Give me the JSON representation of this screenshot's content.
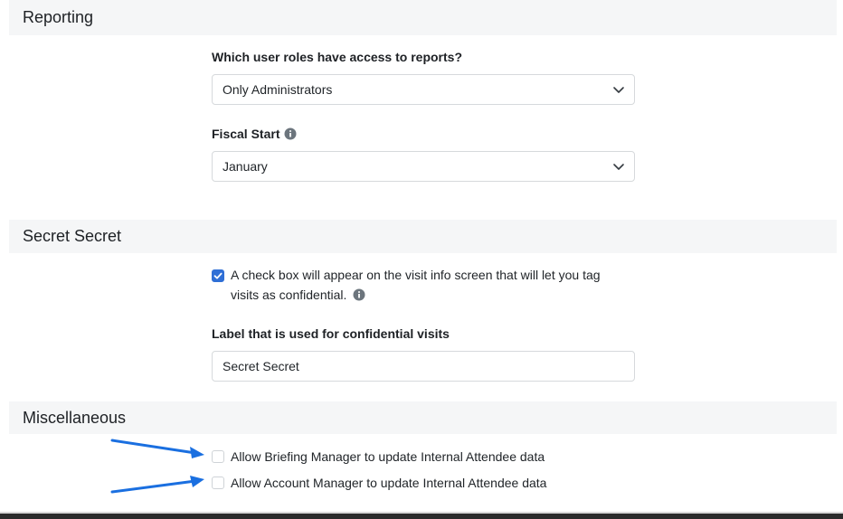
{
  "reporting": {
    "title": "Reporting",
    "roles_label": "Which user roles have access to reports?",
    "roles_value": "Only Administrators",
    "fiscal_label": "Fiscal Start",
    "fiscal_value": "January"
  },
  "secret": {
    "title": "Secret Secret",
    "checkbox_checked": true,
    "checkbox_line1": "A check box will appear on the visit info screen that will let you tag",
    "checkbox_line2": "visits as confidential.",
    "label_label": "Label that is used for confidential visits",
    "label_value": "Secret Secret"
  },
  "misc": {
    "title": "Miscellaneous",
    "options": [
      {
        "label": "Allow Briefing Manager to update Internal Attendee data",
        "checked": false
      },
      {
        "label": "Allow Account Manager to update Internal Attendee data",
        "checked": false
      }
    ]
  },
  "colors": {
    "accent": "#2f6fd6",
    "arrow": "#1a6fe0",
    "section_bg": "#f5f6f7"
  }
}
